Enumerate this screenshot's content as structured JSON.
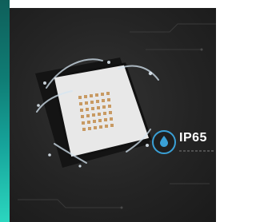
{
  "badge": {
    "label": "IP65",
    "icon": "water-drop-icon",
    "accent_color": "#3aa0d6"
  },
  "colors": {
    "panel_background": "#232323",
    "side_strip": "#16a39a"
  }
}
